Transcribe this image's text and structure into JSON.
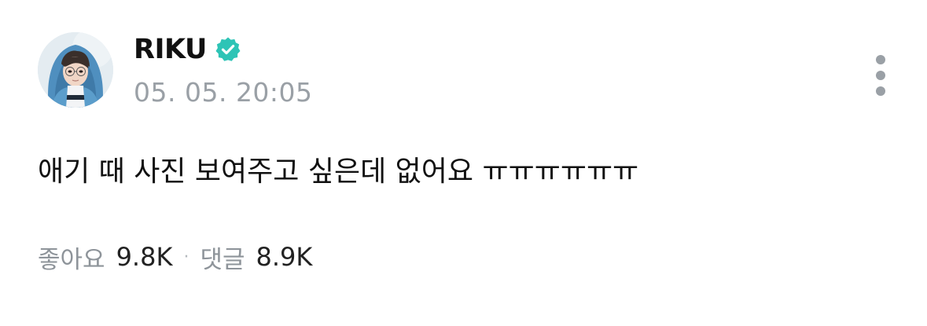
{
  "post": {
    "author": {
      "name": "RIKU",
      "verified": true,
      "verified_color": "#2ec4b6",
      "avatar_icon": "profile-photo"
    },
    "timestamp": "05. 05. 20:05",
    "text": "애기 때 사진 보여주고 싶은데 없어요 ㅠㅠㅠㅠㅠㅠ",
    "stats": {
      "likes_label": "좋아요",
      "likes_value": "9.8K",
      "separator": "·",
      "comments_label": "댓글",
      "comments_value": "8.9K"
    },
    "more_icon": "more-vertical-icon"
  },
  "colors": {
    "text_primary": "#111111",
    "text_secondary": "#9aa0a6",
    "verified_badge": "#2ec4b6"
  }
}
